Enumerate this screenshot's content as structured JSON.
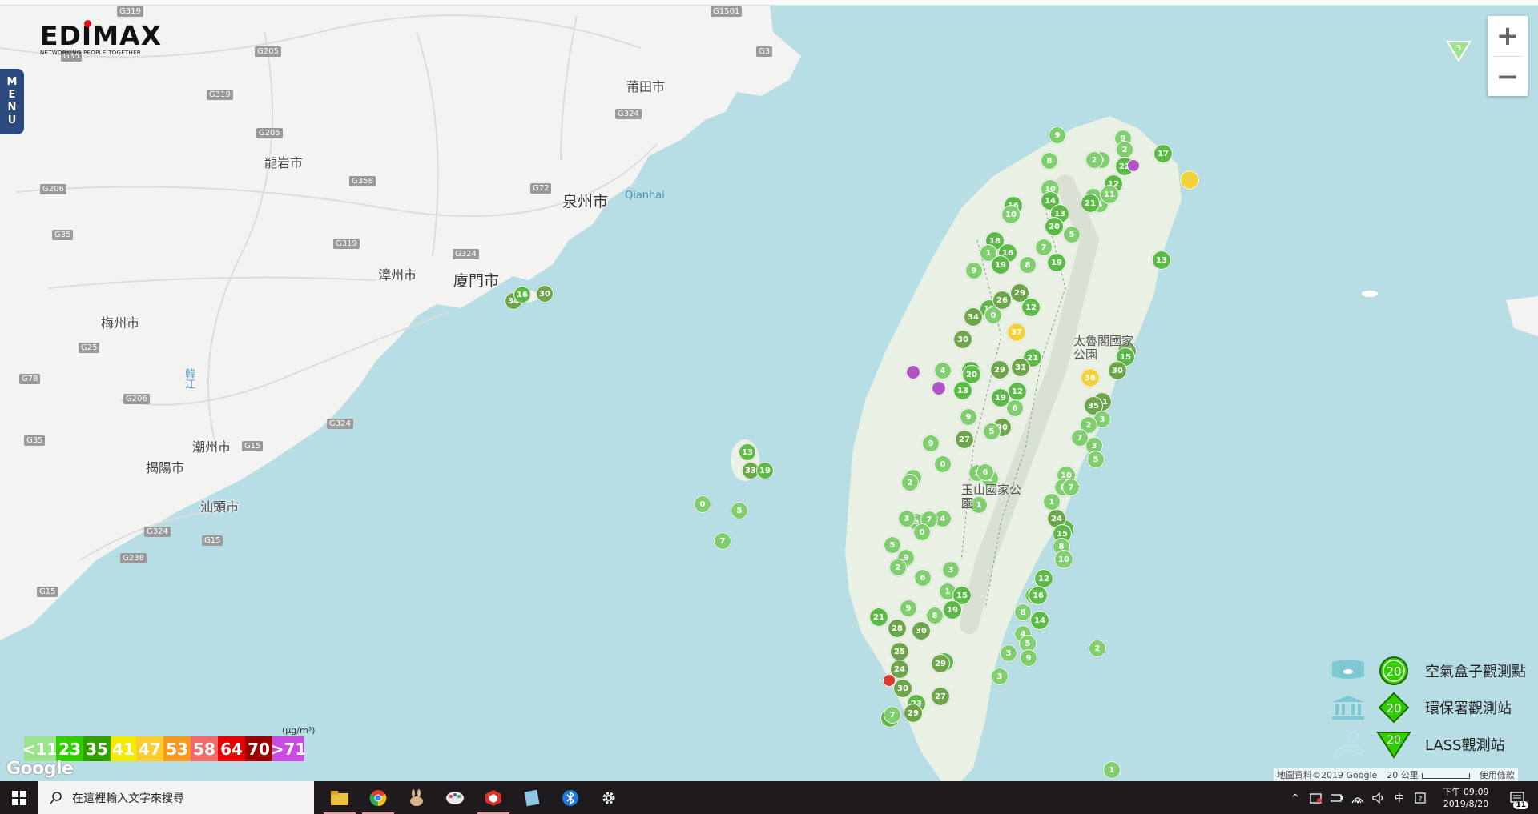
{
  "app": {
    "brand": "EDIMAX",
    "tagline": "NETWORKING PEOPLE TOGETHER",
    "menu_letters": [
      "M",
      "E",
      "N",
      "U"
    ]
  },
  "map": {
    "places": [
      {
        "name": "莆田市",
        "big": false
      },
      {
        "name": "龍岩市",
        "big": false
      },
      {
        "name": "泉州市",
        "big": true
      },
      {
        "name": "漳州市",
        "big": false
      },
      {
        "name": "廈門市",
        "big": true
      },
      {
        "name": "梅州市",
        "big": false
      },
      {
        "name": "潮州市",
        "big": false
      },
      {
        "name": "揭陽市",
        "big": false
      },
      {
        "name": "汕頭市",
        "big": false
      },
      {
        "name": "太魯閣國家公園",
        "big": false
      },
      {
        "name": "玉山國家公園",
        "big": false
      }
    ],
    "highways": [
      "G319",
      "G1501",
      "G35",
      "G205",
      "G3",
      "G319",
      "G324",
      "G205",
      "G358",
      "G72",
      "G206",
      "G324",
      "G319",
      "G35",
      "G25",
      "G78",
      "G206",
      "G324",
      "G35",
      "G15",
      "G324",
      "G15",
      "G238",
      "G15"
    ],
    "water_labels": [
      "Qianhai",
      "韓江"
    ],
    "marker_values": {
      "north": [
        4,
        8,
        0,
        7,
        12,
        5,
        9,
        0,
        2,
        11,
        9,
        13,
        10,
        17,
        21,
        22,
        19,
        2,
        16,
        14,
        10,
        13,
        20,
        18,
        16,
        8,
        1,
        9,
        19,
        29,
        12,
        26,
        12,
        0,
        34,
        30,
        37,
        21,
        31,
        29,
        4,
        16,
        20,
        19,
        12,
        13,
        9,
        6,
        30,
        27,
        5,
        0,
        9,
        5,
        1,
        6,
        3,
        2,
        1,
        5,
        3,
        4,
        7,
        0,
        9,
        5,
        7,
        2,
        6,
        3,
        1,
        15,
        8,
        9,
        19,
        21,
        28,
        30,
        25,
        23,
        24,
        29,
        30,
        23,
        27,
        17,
        29,
        25,
        15,
        30,
        36,
        31,
        35,
        3,
        2,
        3,
        7,
        5,
        10,
        8,
        7,
        1,
        16,
        24,
        15,
        8,
        10,
        12,
        6,
        16,
        14,
        8,
        4,
        5,
        3,
        9
      ],
      "isolated": [
        34,
        16,
        30,
        13,
        33,
        19,
        0,
        5,
        7,
        2,
        1,
        7,
        3
      ]
    },
    "colors": {
      "water": "#b7dde5",
      "land": "#f3f3f1",
      "marker_light": "#7fcf6e",
      "marker_mid": "#5cbb46",
      "marker_dark": "#6da54a",
      "marker_yellow": "#f2d23c",
      "marker_purple": "#b054c4",
      "marker_red": "#d93a2b"
    }
  },
  "zoom": {
    "in_label": "+",
    "out_label": "−"
  },
  "corner_marker_value": "3",
  "aqi_legend": {
    "unit": "(μg/m³)",
    "cells": [
      {
        "label": "<11",
        "color": "#9be48c"
      },
      {
        "label": "23",
        "color": "#31cf00"
      },
      {
        "label": "35",
        "color": "#31a000"
      },
      {
        "label": "41",
        "color": "#f2ec00"
      },
      {
        "label": "47",
        "color": "#ffcd2e"
      },
      {
        "label": "53",
        "color": "#f49a1e"
      },
      {
        "label": "58",
        "color": "#f06a6a"
      },
      {
        "label": "64",
        "color": "#e80000"
      },
      {
        "label": "70",
        "color": "#990000"
      },
      {
        "label": ">71",
        "color": "#c94ce0"
      }
    ]
  },
  "station_legend": [
    {
      "label": "空氣盒子觀測點",
      "value": "20"
    },
    {
      "label": "環保署觀測站",
      "value": "20"
    },
    {
      "label": "LASS觀測站",
      "value": "20"
    }
  ],
  "google_logo": "Google",
  "attribution": {
    "data": "地圖資料©2019 Google",
    "scale": "20 公里",
    "terms": "使用條款"
  },
  "taskbar": {
    "search_placeholder": "在這裡輸入文字來搜尋",
    "ime": "中",
    "time": "下午 09:09",
    "date": "2019/8/20",
    "notification_count": "11"
  }
}
